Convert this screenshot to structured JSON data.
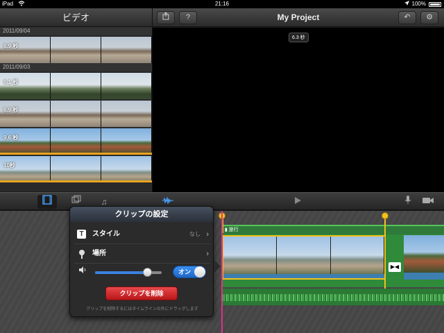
{
  "status_bar": {
    "carrier": "iPad",
    "time": "21:16",
    "battery": "100%",
    "wifi_icon": "wifi-icon",
    "location_icon": "location-arrow-icon"
  },
  "media_browser": {
    "title": "ビデオ",
    "groups": [
      {
        "date": "2011/09/04",
        "clips": [
          {
            "duration": "6.9 秒",
            "style": "sky1",
            "used": false
          }
        ]
      },
      {
        "date": "2011/09/03",
        "clips": [
          {
            "duration": "6.1 秒",
            "style": "sky2",
            "used": false
          },
          {
            "duration": "6.9 秒",
            "style": "sky1",
            "used": false
          },
          {
            "duration": "9.6 秒",
            "style": "sky3",
            "used": true
          },
          {
            "duration": "10秒",
            "style": "sky4",
            "used": true
          }
        ]
      }
    ]
  },
  "viewer": {
    "title": "My Project",
    "duration_badge": "6.3 秒",
    "left_buttons": [
      "export-icon",
      "help-icon"
    ],
    "right_buttons": [
      "undo-icon",
      "gear-icon"
    ]
  },
  "toolbar": {
    "tabs": [
      "video-clips-icon",
      "photos-icon",
      "music-icon"
    ],
    "selected_tab": "video-clips-icon",
    "waveform_icon": "audio-waveform-icon",
    "play_icon": "play-icon",
    "mic_icon": "microphone-icon",
    "camera_icon": "camera-icon"
  },
  "timeline": {
    "title_label": "旅行",
    "transition_icon": "transition-icon"
  },
  "clip_settings": {
    "title": "クリップの設定",
    "style_label": "スタイル",
    "style_value": "なし",
    "location_label": "場所",
    "volume_level": 0.78,
    "audio_toggle_label": "オン",
    "delete_button": "クリップを削除",
    "hint": "クリップを削除するにはタイムラインの外にドラッグします"
  },
  "colors": {
    "accent_blue": "#3b82e0",
    "delete_red": "#d12a2d",
    "selection_yellow": "#f2c21b",
    "playhead_pink": "#e0308a",
    "track_green": "#2f8a3a"
  }
}
